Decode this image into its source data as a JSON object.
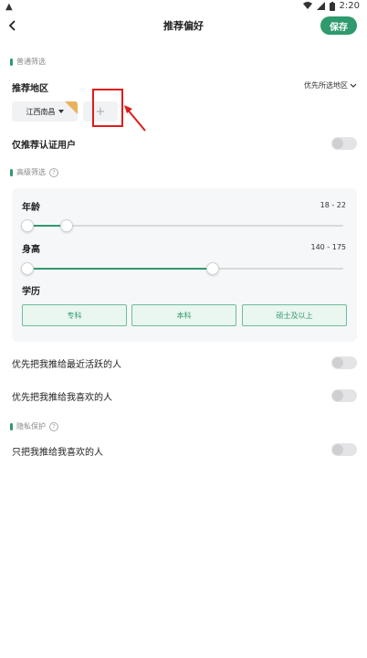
{
  "status": {
    "left_icon": "warning-triangle-icon",
    "time": "2:20"
  },
  "header": {
    "title": "推荐偏好",
    "save_label": "保存"
  },
  "basic": {
    "section_title": "普通筛选",
    "region_label": "推荐地区",
    "pref_link": "优先所选地区",
    "region_chip": "江西南昌",
    "add_symbol": "+",
    "verified_label": "仅推荐认证用户",
    "verified_on": false
  },
  "advanced": {
    "section_title": "高级筛选",
    "age_label": "年龄",
    "age_value": "18 - 22",
    "age_range": [
      0,
      0.13
    ],
    "height_label": "身高",
    "height_value": "140 - 175",
    "height_range": [
      0,
      0.59
    ],
    "edu_label": "学历",
    "edu_options": [
      "专科",
      "本科",
      "硕士及以上"
    ]
  },
  "priority": {
    "active_label": "优先把我推给最近活跃的人",
    "active_on": false,
    "liked_label": "优先把我推给我喜欢的人",
    "liked_on": false
  },
  "privacy": {
    "section_title": "隐私保护",
    "only_liked_label": "只把我推给我喜欢的人",
    "only_liked_on": false
  },
  "colors": {
    "accent": "#2e9a6d",
    "highlight": "#e01b1b"
  }
}
